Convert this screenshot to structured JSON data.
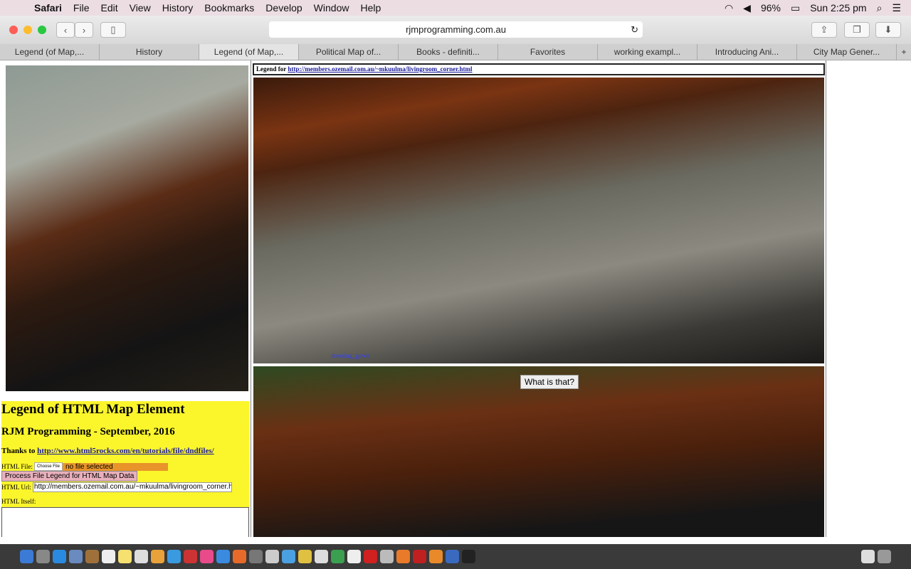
{
  "menubar": {
    "app": "Safari",
    "items": [
      "File",
      "Edit",
      "View",
      "History",
      "Bookmarks",
      "Develop",
      "Window",
      "Help"
    ],
    "battery": "96%",
    "clock": "Sun 2:25 pm"
  },
  "browser": {
    "url": "rjmprogramming.com.au",
    "tabs": [
      "Legend (of Map,...",
      "History",
      "Legend (of Map,...",
      "Political Map of...",
      "Books - definiti...",
      "Favorites",
      "working exampl...",
      "Introducing Ani...",
      "City Map Gener..."
    ],
    "active_tab": 2
  },
  "page": {
    "legend_prefix": "Legend for",
    "legend_link": "http://members.ozemail.com.au/~mkuulma/livingroom_corner.html",
    "area_label": "dressing_gown",
    "tooltip": "What is that?",
    "title": "Legend of HTML Map Element",
    "subtitle": "RJM Programming - September, 2016",
    "thanks_prefix": "Thanks to",
    "thanks_link": "http://www.html5rocks.com/en/tutorials/file/dndfiles/",
    "file_label": "HTML File:",
    "choose_file": "Choose File",
    "no_file": "no file selected",
    "process_button": "Process File Legend for HTML Map Data",
    "url_label": "HTML Url:",
    "url_value": "http://members.ozemail.com.au/~mkuulma/livingroom_corner.html",
    "itself_label": "HTML Itself:"
  },
  "colors": {
    "panel": "#fbf52c",
    "file_bar": "#e8942a",
    "process_button": "#e8b0bc"
  }
}
